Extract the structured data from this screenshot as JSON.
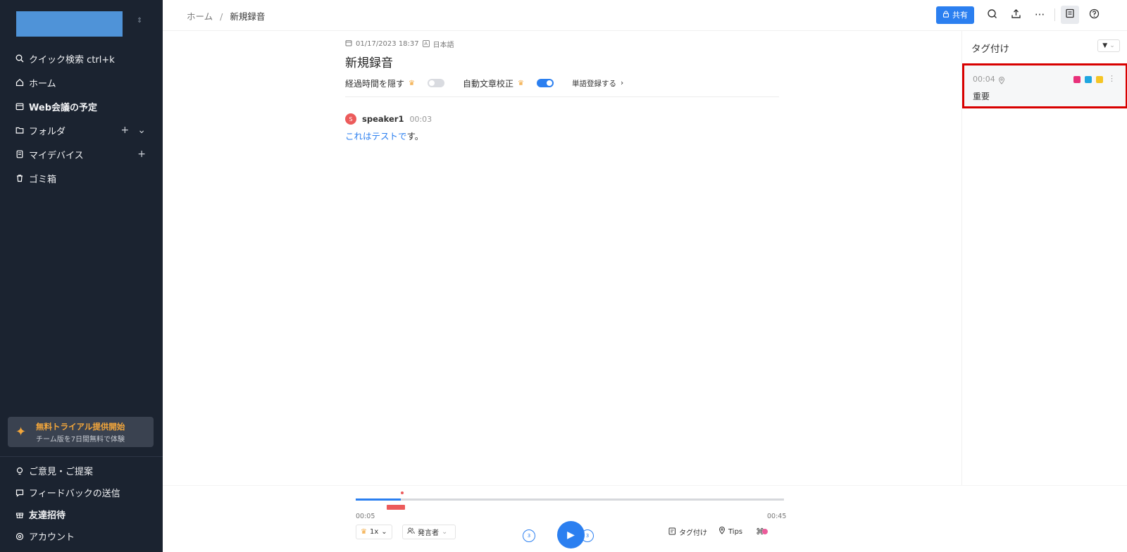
{
  "sidebar": {
    "switch_icon": "⇕",
    "nav": [
      {
        "icon": "search-icon",
        "label": "クイック検索 ctrl+k"
      },
      {
        "icon": "home-icon",
        "label": "ホーム"
      },
      {
        "icon": "calendar-icon",
        "label": "Web会議の予定"
      },
      {
        "icon": "folder-icon",
        "label": "フォルダ"
      },
      {
        "icon": "device-icon",
        "label": "マイデバイス"
      },
      {
        "icon": "trash-icon",
        "label": "ゴミ箱"
      }
    ],
    "trial": {
      "title": "無料トライアル提供開始",
      "subtitle": "チーム版を7日間無料で体験"
    },
    "bottom_nav": [
      {
        "icon": "lightbulb-icon",
        "label": "ご意見・ご提案"
      },
      {
        "icon": "feedback-icon",
        "label": "フィードバックの送信"
      },
      {
        "icon": "gift-icon",
        "label": "友達招待"
      },
      {
        "icon": "account-icon",
        "label": "アカウント"
      }
    ],
    "colors": {
      "bg": "#1b2330",
      "accent": "#f2a63b",
      "logo": "#4f93d8"
    }
  },
  "header": {
    "breadcrumb": {
      "home": "ホーム",
      "separator": "/",
      "current": "新規録音"
    },
    "share_label": "共有",
    "more_glyph": "···"
  },
  "recording": {
    "date": "01/17/2023 18:37",
    "language_badge": "A",
    "language": "日本語",
    "title": "新規録音",
    "options": {
      "hide_elapsed": {
        "label": "経過時間を隠す",
        "enabled": false
      },
      "auto_correct": {
        "label": "自動文章校正",
        "enabled": true
      },
      "vocab_label": "単語登録する"
    },
    "segments": [
      {
        "speaker_initial": "S",
        "speaker": "speaker1",
        "time": "00:03",
        "text_highlight": "これはテストで",
        "text_rest": "す。"
      }
    ]
  },
  "tags_panel": {
    "title": "タグ付け",
    "tags": [
      {
        "time": "00:04",
        "text": "重要",
        "colors": [
          "#e8317a",
          "#1fa6e0",
          "#f5c524"
        ]
      }
    ]
  },
  "player": {
    "current_time": "00:05",
    "total_time": "00:45",
    "progress_fraction": 0.105,
    "marker_fraction": 0.108,
    "tag_segment": {
      "start_fraction": 0.073,
      "end_fraction": 0.115
    },
    "speed": "1x",
    "speaker_filter": "発言者",
    "skip_seconds": "3",
    "tag_label": "タグ付け",
    "tips_label": "Tips",
    "accent": "#2b7ff0"
  }
}
